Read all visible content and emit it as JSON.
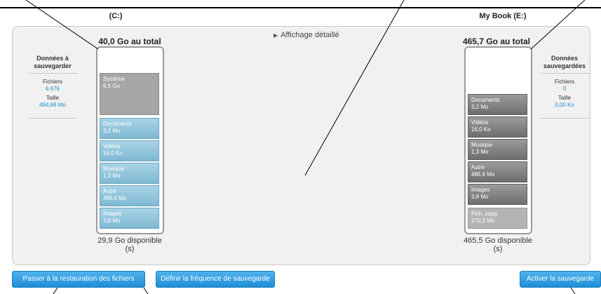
{
  "drives": {
    "source": {
      "name": "(C:)",
      "total": "40,0 Go au total",
      "available": "29,9 Go disponible (s)",
      "segments": [
        {
          "label": "Système",
          "size": "9,6 Go",
          "kind": "system"
        },
        {
          "label": "Documents",
          "size": "3,2 Mo",
          "kind": "blue"
        },
        {
          "label": "Vidéos",
          "size": "16,0 Ko",
          "kind": "blue"
        },
        {
          "label": "Musique",
          "size": "1,3 Mo",
          "kind": "blue"
        },
        {
          "label": "Autre",
          "size": "486,6 Mo",
          "kind": "blue"
        },
        {
          "label": "Images",
          "size": "3,8 Mo",
          "kind": "blue"
        }
      ]
    },
    "target": {
      "name": "My Book (E:)",
      "total": "465,7 Go au total",
      "available": "465,5 Go disponible (s)",
      "segments": [
        {
          "label": "Documents",
          "size": "3,2 Mo",
          "kind": "gray"
        },
        {
          "label": "Vidéos",
          "size": "16,0 Ko",
          "kind": "gray"
        },
        {
          "label": "Musique",
          "size": "1,3 Mo",
          "kind": "gray"
        },
        {
          "label": "Autre",
          "size": "486,6 Mo",
          "kind": "gray"
        },
        {
          "label": "Images",
          "size": "3,8 Mo",
          "kind": "gray"
        },
        {
          "label": "Fich. supp.",
          "size": "270,2 Mo",
          "kind": "supp"
        }
      ]
    }
  },
  "detail_toggle": "Affichage détaillé",
  "left_stats": {
    "title_1": "Données à",
    "title_2": "sauvegarder",
    "files_label": "Fichiers",
    "files_value": "6 676",
    "size_label": "Taille",
    "size_value": "494,88 Mo"
  },
  "right_stats": {
    "title_1": "Données",
    "title_2": "sauvegardées",
    "files_label": "Fichiers",
    "files_value": "0",
    "size_label": "Taille",
    "size_value": "0,00 Ko"
  },
  "buttons": {
    "restore": "Passer à la restauration des fichiers",
    "frequency": "Définir la fréquence de sauvegarde",
    "activate": "Activer la sauvegarde"
  },
  "colors": {
    "button": "#2a9ae0",
    "stat_value": "#1e90c8"
  }
}
